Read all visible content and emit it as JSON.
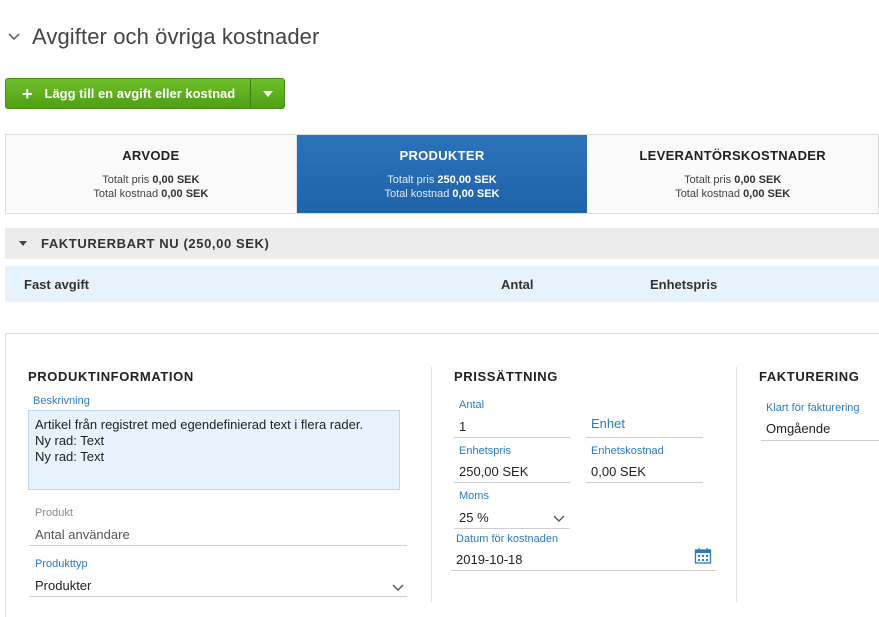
{
  "header": {
    "title": "Avgifter och övriga kostnader"
  },
  "add_button": {
    "label": "Lägg till en avgift eller kostnad"
  },
  "tabs": [
    {
      "name": "ARVODE",
      "price_label": "Totalt pris",
      "price": "0,00 SEK",
      "cost_label": "Total kostnad",
      "cost": "0,00 SEK"
    },
    {
      "name": "PRODUKTER",
      "price_label": "Totalt pris",
      "price": "250,00 SEK",
      "cost_label": "Total kostnad",
      "cost": "0,00 SEK"
    },
    {
      "name": "LEVERANTÖRSKOSTNADER",
      "price_label": "Totalt pris",
      "price": "0,00 SEK",
      "cost_label": "Total kostnad",
      "cost": "0,00 SEK"
    }
  ],
  "group": {
    "title": "FAKTURERBART NU (250,00 SEK)"
  },
  "columns": {
    "c1": "Fast avgift",
    "c2": "Antal",
    "c3": "Enhetspris"
  },
  "produktinfo": {
    "title": "PRODUKTINFORMATION",
    "beskrivning_label": "Beskrivning",
    "beskrivning_lines": [
      "Artikel från registret med egendefinierad text i flera rader.",
      "Ny rad: Text",
      "Ny rad: Text"
    ],
    "produkt_label": "Produkt",
    "produkt_value": "Antal användare",
    "produkttyp_label": "Produkttyp",
    "produkttyp_value": "Produkter"
  },
  "prissattning": {
    "title": "PRISSÄTTNING",
    "antal_label": "Antal",
    "antal_value": "1",
    "enhet_label": "Enhet",
    "enhetspris_label": "Enhetspris",
    "enhetspris_value": "250,00 SEK",
    "enhetskostnad_label": "Enhetskostnad",
    "enhetskostnad_value": "0,00 SEK",
    "moms_label": "Moms",
    "moms_value": "25 %",
    "datum_label": "Datum för kostnaden",
    "datum_value": "2019-10-18"
  },
  "fakturering": {
    "title": "FAKTURERING",
    "klart_label": "Klart för fakturering",
    "klart_value": "Omgående"
  },
  "colors": {
    "accent": "#2a7ac7",
    "active_tab": "#2468b0",
    "green": "#5aab1d"
  }
}
